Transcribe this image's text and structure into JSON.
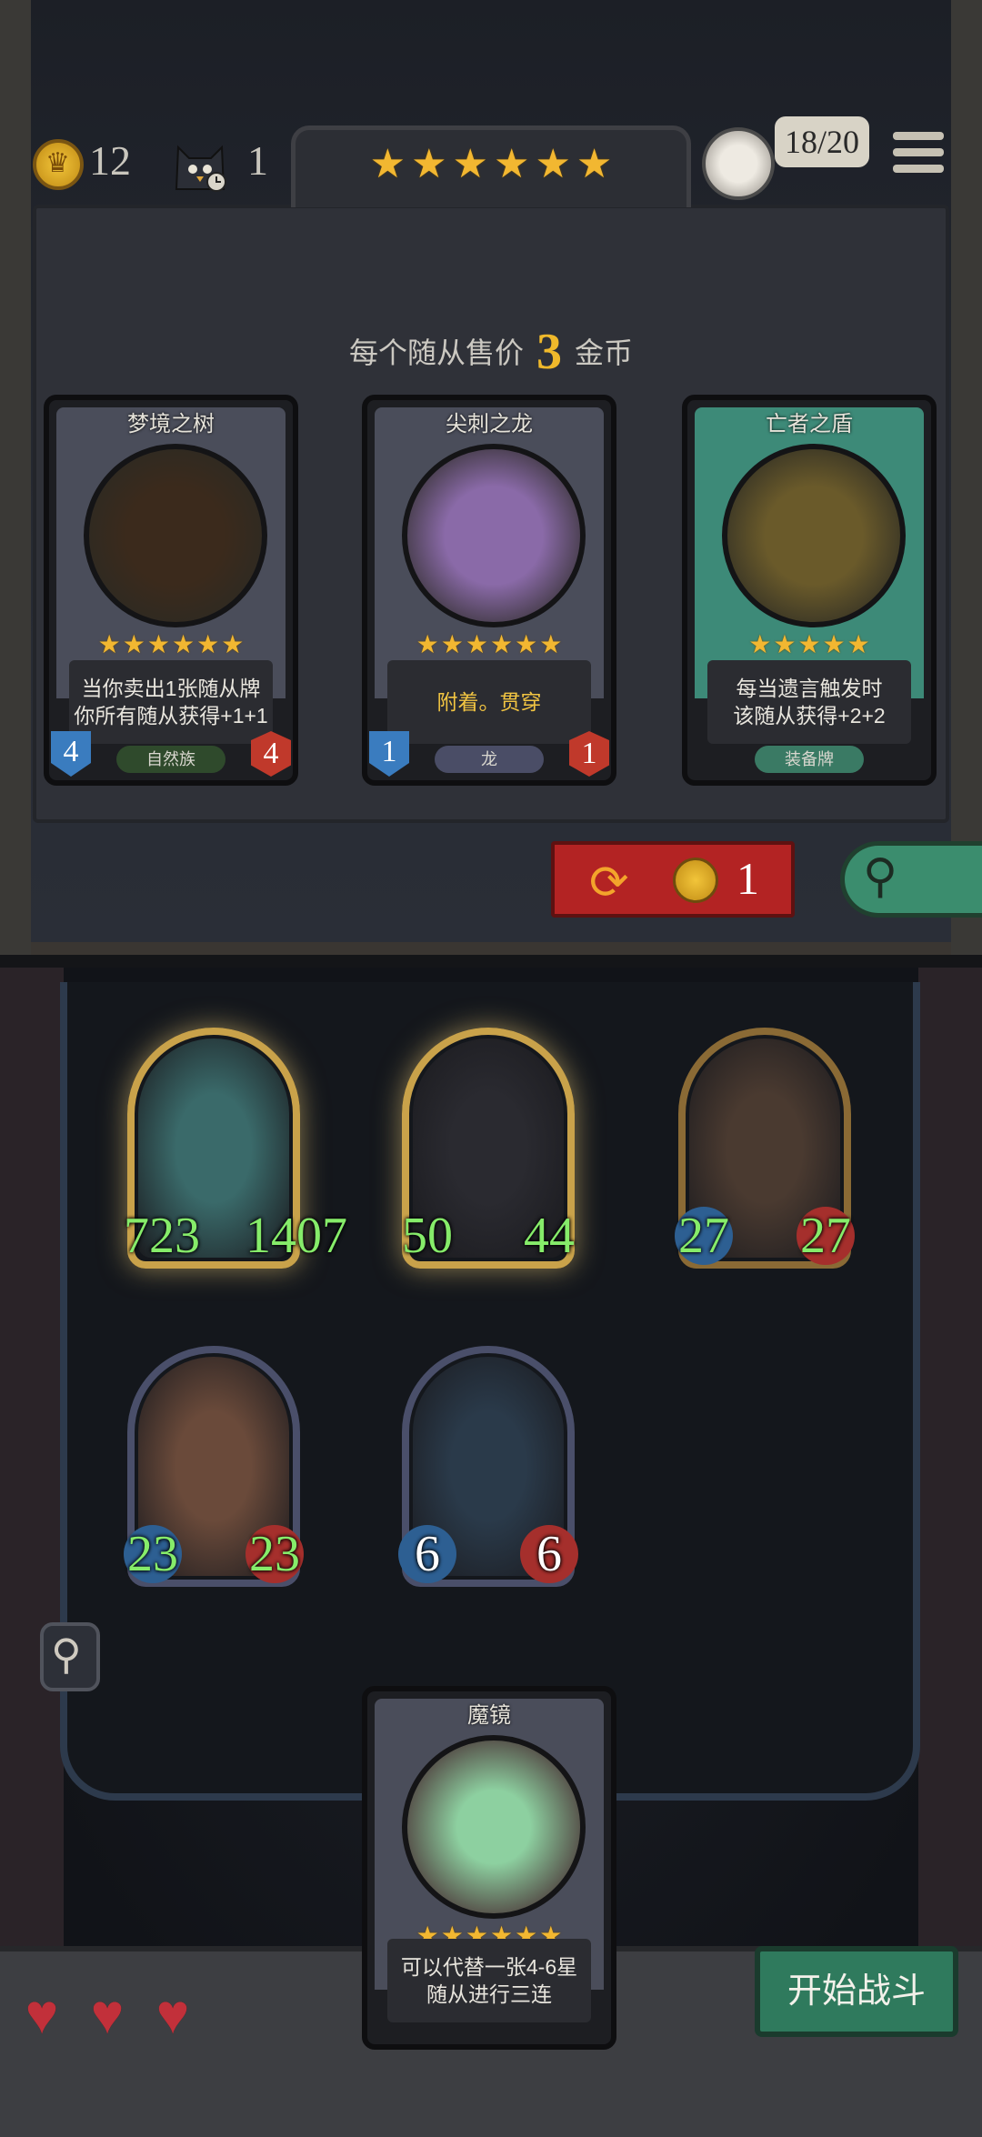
{
  "header": {
    "gold": "12",
    "turn": "1",
    "tier_stars": 6,
    "population": "18/20"
  },
  "shop": {
    "sell_prefix": "每个随从售价",
    "sell_price": "3",
    "sell_suffix": "金币",
    "cards": [
      {
        "name": "梦境之树",
        "stars": 6,
        "desc1": "当你卖出1张随从牌",
        "desc2": "你所有随从获得+1+1",
        "tribe": "自然族",
        "attack": "4",
        "health": "4",
        "theme": "#4a4d5a",
        "art": "#3b2a1c",
        "tribe_color": "#2f4a2c"
      },
      {
        "name": "尖刺之龙",
        "stars": 6,
        "desc1": "附着。贯穿",
        "desc2": "",
        "tribe": "龙",
        "attack": "1",
        "health": "1",
        "theme": "#4a4d5a",
        "art": "#8a6aa8",
        "tribe_color": "#4a4d66"
      },
      {
        "name": "亡者之盾",
        "stars": 5,
        "desc1": "每当遗言触发时",
        "desc2": "该随从获得+2+2",
        "tribe": "装备牌",
        "attack": "",
        "health": "",
        "theme": "#3d8a78",
        "art": "#6a5a2a",
        "tribe_color": "#3a7a64"
      }
    ],
    "refresh_cost": "1"
  },
  "board": {
    "minions": [
      {
        "attack": "723",
        "health": "1407",
        "style": "gold",
        "color": "#3a6a6a"
      },
      {
        "attack": "50",
        "health": "44",
        "style": "gold",
        "color": "#2a2a30"
      },
      {
        "attack": "27",
        "health": "27",
        "style": "bronze",
        "color": "#4a3a30"
      },
      {
        "attack": "23",
        "health": "23",
        "style": "plain",
        "color": "#6a4a3a"
      },
      {
        "attack": "6",
        "health": "6",
        "style": "plain",
        "color": "#2a3a4a"
      }
    ]
  },
  "hand": {
    "name": "魔镜",
    "stars": 6,
    "desc1": "可以代替一张4-6星",
    "desc2": "随从进行三连"
  },
  "hearts": 3,
  "battle_label": "开始战斗",
  "icons": {
    "gold": "coin-icon",
    "turn": "cat-clock-icon",
    "menu": "menu-icon",
    "refresh": "refresh-icon",
    "search": "search-icon",
    "heart": "heart-icon"
  }
}
